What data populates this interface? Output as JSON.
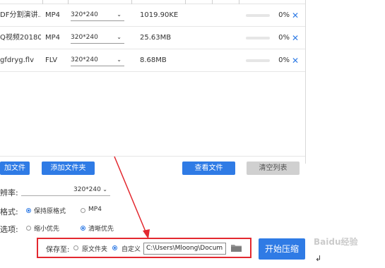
{
  "files": [
    {
      "name": "DF分割演讲...",
      "format": "MP4",
      "resolution": "320*240",
      "size": "1019.90KE",
      "progress_pct": 0,
      "progress_text": "0%"
    },
    {
      "name": "Q视频20180...",
      "format": "MP4",
      "resolution": "320*240",
      "size": "25.63MB",
      "progress_pct": 0,
      "progress_text": "0%"
    },
    {
      "name": "gfdryg.flv",
      "format": "FLV",
      "resolution": "320*240",
      "size": "8.68MB",
      "progress_pct": 0,
      "progress_text": "0%"
    }
  ],
  "toolbar": {
    "add_file_label": "加文件",
    "add_folder_label": "添加文件夹",
    "view_file_label": "查看文件",
    "clear_list_label": "清空列表"
  },
  "settings": {
    "resolution_label": "辨率:",
    "resolution_value": "320*240",
    "format_label": "格式:",
    "format_options": [
      "保持原格式",
      "MP4"
    ],
    "format_selected": "保持原格式",
    "priority_label": "选项:",
    "priority_options": [
      "缩小优先",
      "清晰优先"
    ],
    "priority_selected": "清晰优先"
  },
  "save": {
    "label": "保存至:",
    "options": [
      "原文件夹",
      "自定义"
    ],
    "selected": "自定义",
    "path": "C:\\Users\\Mloong\\Docum"
  },
  "start_button_label": "开始压缩",
  "watermark_text": "Baidu经验",
  "colors": {
    "accent": "#2f7be5",
    "highlight_box": "#e3282f",
    "close_x": "#2f7be5"
  },
  "icons": {
    "folder": "folder-icon",
    "delete": "close-icon",
    "dropdown": "chevron-down-icon"
  }
}
